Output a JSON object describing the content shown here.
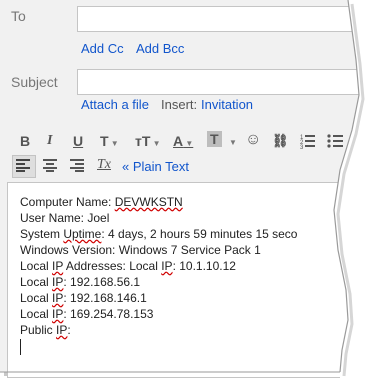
{
  "compose": {
    "to_label": "To",
    "add_cc": "Add Cc",
    "add_bcc": "Add Bcc",
    "subject_label": "Subject",
    "attach_file": "Attach a file",
    "insert_label": "Insert:",
    "invitation": "Invitation"
  },
  "toolbar": {
    "bold": "B",
    "italic": "I",
    "underline": "U",
    "font": "T",
    "size": "тT",
    "text_color": "A",
    "bg_color": "T",
    "emoji": "☺",
    "link": "⛓",
    "plain_text": "« Plain Text",
    "remove_format": "Tx"
  },
  "body": {
    "lines": [
      "Computer Name: DEVWKSTN",
      "User Name: Joel",
      "System Uptime: 4 days, 2 hours 59 minutes 15 seco",
      "Windows Version: Windows 7 Service Pack 1",
      "Local IP Addresses: Local IP: 10.1.10.12",
      "Local IP: 192.168.56.1",
      "Local IP: 192.168.146.1",
      "Local IP: 169.254.78.153",
      "Public IP:"
    ]
  }
}
